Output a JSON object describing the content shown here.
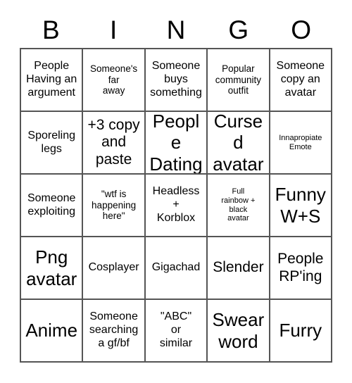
{
  "card": {
    "title": "BINGO",
    "header_letters": [
      "B",
      "I",
      "N",
      "G",
      "O"
    ],
    "columns": 5,
    "rows": 5,
    "grid_color": "#555555",
    "background_color": "#ffffff",
    "text_color": "#000000",
    "cells": [
      [
        {
          "text": "People\nHaving an\nargument",
          "size": "m"
        },
        {
          "text": "Someone's\nfar\naway",
          "size": "s"
        },
        {
          "text": "Someone\nbuys\nsomething",
          "size": "m"
        },
        {
          "text": "Popular\ncommunity\noutfit",
          "size": "s"
        },
        {
          "text": "Someone\ncopy an\navatar",
          "size": "m"
        }
      ],
      [
        {
          "text": "Sporeling\nlegs",
          "size": "m"
        },
        {
          "text": "+3 copy\nand\npaste",
          "size": "l"
        },
        {
          "text": "People\nDating",
          "size": "xl"
        },
        {
          "text": "Cursed\navatar",
          "size": "xl"
        },
        {
          "text": "Innapropiate\nEmote",
          "size": "xs"
        }
      ],
      [
        {
          "text": "Someone\nexploiting",
          "size": "m"
        },
        {
          "text": "\"wtf is\nhappening\nhere\"",
          "size": "s"
        },
        {
          "text": "Headless\n+\nKorblox",
          "size": "m"
        },
        {
          "text": "Full\nrainbow +\nblack\navatar",
          "size": "xs"
        },
        {
          "text": "Funny\nW+S",
          "size": "xl"
        }
      ],
      [
        {
          "text": "Png\navatar",
          "size": "xl"
        },
        {
          "text": "Cosplayer",
          "size": "m"
        },
        {
          "text": "Gigachad",
          "size": "m"
        },
        {
          "text": "Slender",
          "size": "l"
        },
        {
          "text": "People\nRP'ing",
          "size": "l"
        }
      ],
      [
        {
          "text": "Anime",
          "size": "xl"
        },
        {
          "text": "Someone\nsearching\na gf/bf",
          "size": "m"
        },
        {
          "text": "\"ABC\"\nor\nsimilar",
          "size": "m"
        },
        {
          "text": "Swear\nword",
          "size": "xl"
        },
        {
          "text": "Furry",
          "size": "xl"
        }
      ]
    ]
  }
}
